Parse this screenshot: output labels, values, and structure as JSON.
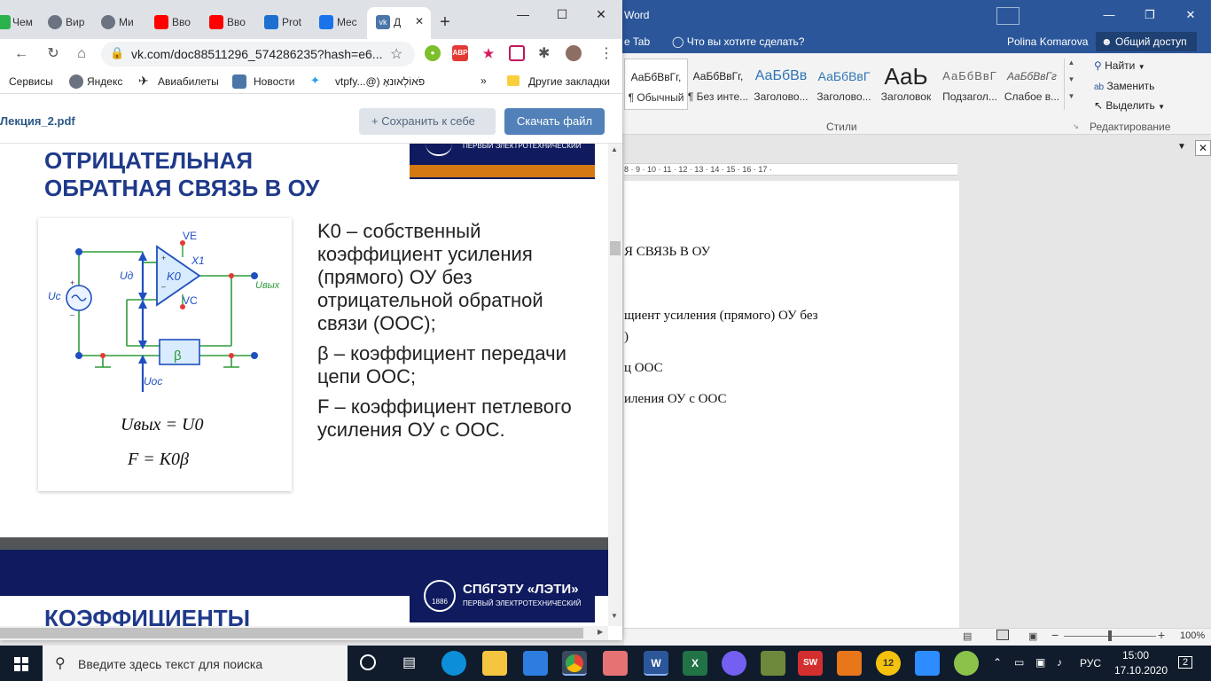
{
  "word": {
    "title": "Word",
    "tell_tab": "e Tab",
    "tell_me": "Что вы хотите сделать?",
    "user": "Polina Komarova",
    "share": "Общий доступ",
    "styles": [
      {
        "preview": "АаБбВвГг,",
        "name": "¶ Обычный"
      },
      {
        "preview": "АаБбВвГг,",
        "name": "¶ Без инте..."
      },
      {
        "preview": "АаБбВв",
        "name": "Заголово..."
      },
      {
        "preview": "АаБбВвГ",
        "name": "Заголово..."
      },
      {
        "preview": "АаЬ",
        "name": "Заголовок"
      },
      {
        "preview": "АаБбВвГ",
        "name": "Подзагол..."
      },
      {
        "preview": "АаБбВвГг",
        "name": "Слабое в..."
      }
    ],
    "styles_group": "Стили",
    "editing_group": "Редактирование",
    "find": "Найти",
    "replace": "Заменить",
    "select": "Выделить",
    "ruler": "8 · 9 · 10 · 11 · 12 · 13 · 14 · 15 · 16 · 17 ·",
    "doc_lines": [
      "Я СВЯЗЬ В ОУ",
      "щиент   усиления   (прямого)   ОУ   без",
      ")",
      "ц ООС",
      "иления ОУ с ООС"
    ],
    "zoom": "100%"
  },
  "chrome": {
    "tabs": [
      {
        "label": "Чем",
        "color": "#2bb24c"
      },
      {
        "label": "Вир",
        "color": "#6b7280"
      },
      {
        "label": "Ми",
        "color": "#6b7280"
      },
      {
        "label": "Вво",
        "color": "#ff0000"
      },
      {
        "label": "Вво",
        "color": "#ff0000"
      },
      {
        "label": "Prot",
        "color": "#1f6fd1"
      },
      {
        "label": "Mec",
        "color": "#1a73e8"
      },
      {
        "label": "Д",
        "color": "#4a76a8"
      }
    ],
    "url": "vk.com/doc88511296_574286235?hash=e6...",
    "bookmarks": [
      "Сервисы",
      "Яндекс",
      "Авиабилеты",
      "Новости",
      "vtpfy...@) פֹאוֹלְאוּנאָ",
      "Другие закладки"
    ]
  },
  "vk": {
    "filename": "Лекция_2.pdf",
    "save": "Сохранить к себе",
    "download": "Скачать файл"
  },
  "slide1": {
    "title": "ОТРИЦАТЕЛЬНАЯ ОБРАТНАЯ СВЯЗЬ В ОУ",
    "logo_sub": "ПЕРВЫЙ ЭЛЕКТРОТЕХНИЧЕСКИЙ",
    "circuit": {
      "ve": "VE",
      "vc": "VC",
      "x1": "X1",
      "k0": "K0",
      "ud": "Uд",
      "uc": "Uc",
      "uout": "Uвых",
      "uos": "Uос",
      "beta": "β"
    },
    "formula1": "Uвых = U0",
    "formula2": "F = K0β",
    "text": [
      "K0 – собственный коэффициент усиления (прямого) ОУ без отрицательной обратной связи (ООС);",
      "β – коэффициент передачи цепи ООС;",
      "F – коэффициент петлевого усиления ОУ с ООС."
    ]
  },
  "slide2": {
    "logo_title": "СПбГЭТУ «ЛЭТИ»",
    "logo_year": "1886",
    "logo_sub": "ПЕРВЫЙ ЭЛЕКТРОТЕХНИЧЕСКИЙ",
    "title": "КОЭФФИЦИЕНТЫ"
  },
  "taskbar": {
    "search": "Введите здесь текст для поиска",
    "lang": "РУС",
    "time": "15:00",
    "date": "17.10.2020",
    "notifications": "2"
  }
}
